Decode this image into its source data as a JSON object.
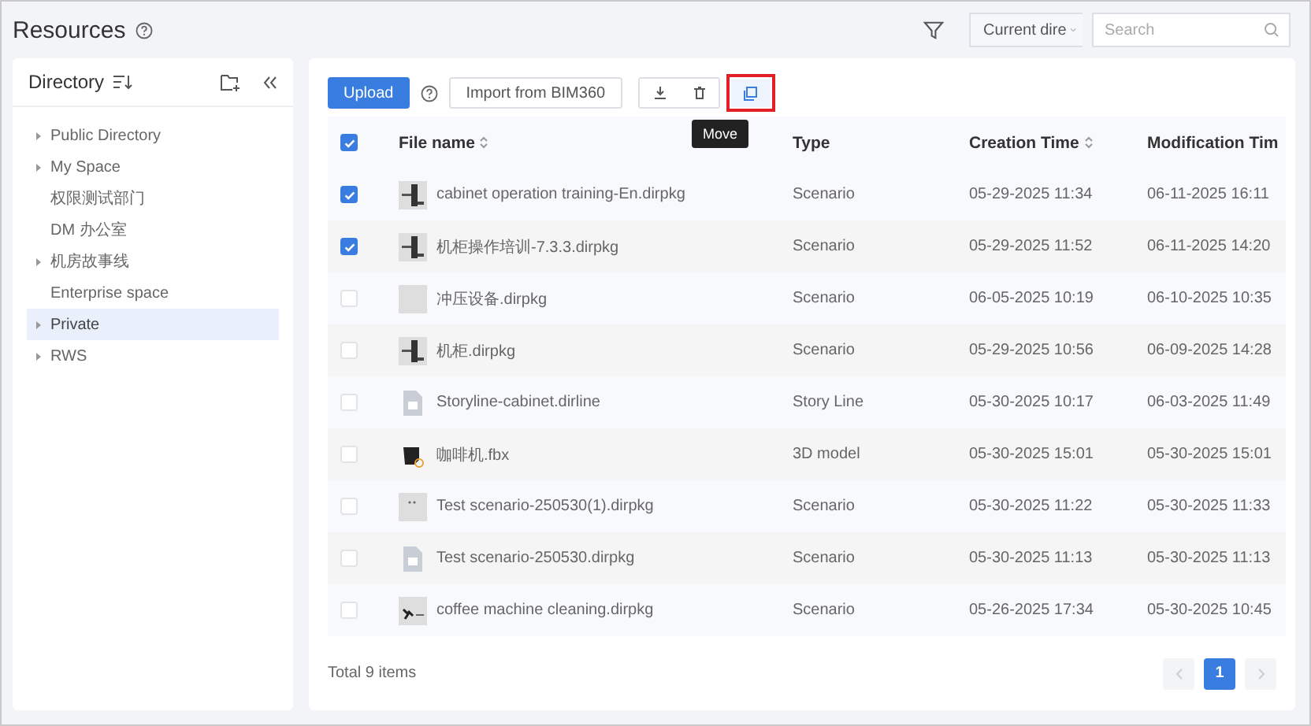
{
  "header": {
    "title": "Resources",
    "scope_select": {
      "value": "Current dire"
    },
    "search": {
      "placeholder": "Search"
    }
  },
  "sidebar": {
    "title": "Directory",
    "items": [
      {
        "label": "Public Directory",
        "expandable": true,
        "selected": false
      },
      {
        "label": "My Space",
        "expandable": true,
        "selected": false
      },
      {
        "label": "权限测试部门",
        "expandable": false,
        "selected": false
      },
      {
        "label": "DM 办公室",
        "expandable": false,
        "selected": false
      },
      {
        "label": "机房故事线",
        "expandable": true,
        "selected": false
      },
      {
        "label": "Enterprise space",
        "expandable": false,
        "selected": false
      },
      {
        "label": "Private",
        "expandable": true,
        "selected": true
      },
      {
        "label": "RWS",
        "expandable": true,
        "selected": false
      }
    ]
  },
  "toolbar": {
    "upload": "Upload",
    "import": "Import from BIM360",
    "move_highlighted": true,
    "tooltip": "Move"
  },
  "table": {
    "all_checked": true,
    "columns": [
      {
        "label": "File name",
        "sortable": true
      },
      {
        "label": "Type",
        "sortable": false
      },
      {
        "label": "Creation Time",
        "sortable": true
      },
      {
        "label": "Modification Tim",
        "sortable": false
      }
    ],
    "rows": [
      {
        "checked": true,
        "kind": "cabinet",
        "name": "cabinet operation training-En.dirpkg",
        "type": "Scenario",
        "created": "05-29-2025 11:34",
        "modified": "06-11-2025 16:11"
      },
      {
        "checked": true,
        "kind": "cabinet",
        "name": "机柜操作培训-7.3.3.dirpkg",
        "type": "Scenario",
        "created": "05-29-2025 11:52",
        "modified": "06-11-2025 14:20"
      },
      {
        "checked": false,
        "kind": "blank",
        "name": "冲压设备.dirpkg",
        "type": "Scenario",
        "created": "06-05-2025 10:19",
        "modified": "06-10-2025 10:35"
      },
      {
        "checked": false,
        "kind": "cabinet",
        "name": "机柜.dirpkg",
        "type": "Scenario",
        "created": "05-29-2025 10:56",
        "modified": "06-09-2025 14:28"
      },
      {
        "checked": false,
        "kind": "document",
        "name": "Storyline-cabinet.dirline",
        "type": "Story Line",
        "created": "05-30-2025 10:17",
        "modified": "06-03-2025 11:49"
      },
      {
        "checked": false,
        "kind": "model",
        "name": "咖啡机.fbx",
        "type": "3D model",
        "created": "05-30-2025 15:01",
        "modified": "05-30-2025 15:01"
      },
      {
        "checked": false,
        "kind": "dots",
        "name": "Test scenario-250530(1).dirpkg",
        "type": "Scenario",
        "created": "05-30-2025 11:22",
        "modified": "05-30-2025 11:33"
      },
      {
        "checked": false,
        "kind": "document",
        "name": "Test scenario-250530.dirpkg",
        "type": "Scenario",
        "created": "05-30-2025 11:13",
        "modified": "05-30-2025 11:13"
      },
      {
        "checked": false,
        "kind": "machine",
        "name": "coffee machine cleaning.dirpkg",
        "type": "Scenario",
        "created": "05-26-2025 17:34",
        "modified": "05-30-2025 10:45"
      }
    ]
  },
  "footer": {
    "total": "Total 9 items",
    "pages": [
      {
        "label": "1",
        "selected": true
      }
    ]
  }
}
